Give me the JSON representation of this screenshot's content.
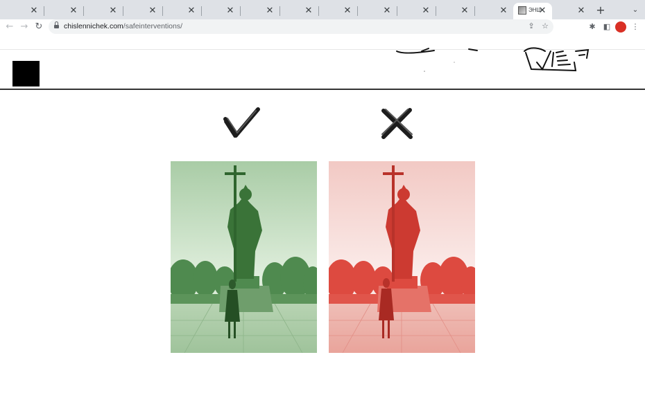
{
  "browser": {
    "tabs": [
      {
        "title": ""
      },
      {
        "title": ""
      },
      {
        "title": ""
      },
      {
        "title": ""
      },
      {
        "title": ""
      },
      {
        "title": ""
      },
      {
        "title": ""
      },
      {
        "title": ""
      },
      {
        "title": ""
      },
      {
        "title": ""
      },
      {
        "title": ""
      },
      {
        "title": ""
      },
      {
        "title": "ЭНШ",
        "active": true
      },
      {
        "title": ""
      }
    ],
    "close_glyph": "✕",
    "new_tab_glyph": "+",
    "url_host": "chislennichek.com",
    "url_path": "/safeinterventions/",
    "icons": [
      "back-icon",
      "forward-icon",
      "reload-icon",
      "lock-icon",
      "share-icon",
      "bookmark-star-icon",
      "extensions-icon",
      "side-panel-icon",
      "profile-avatar",
      "kebab-menu-icon"
    ],
    "profile_color": "#d93025"
  },
  "page": {
    "good_example": {
      "icon": "checkmark-icon",
      "tint": "#5f9b5f"
    },
    "bad_example": {
      "icon": "cross-icon",
      "tint": "#e0443c"
    }
  }
}
